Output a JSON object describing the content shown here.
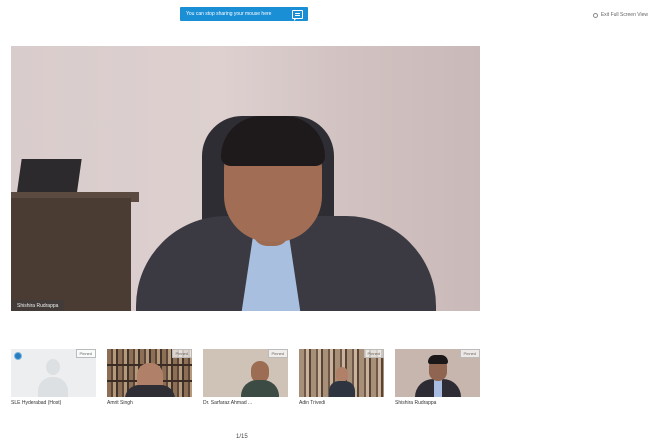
{
  "share_banner": {
    "text": "You can stop sharing your mouse here"
  },
  "exit_fullscreen": {
    "label": "Exit Full Screen View"
  },
  "main_video": {
    "name_tag": "Shishira Rudrappa"
  },
  "participants": [
    {
      "name": "SLE Hyderabad (Host)",
      "tag": "Pinned"
    },
    {
      "name": "Amrit Singh",
      "tag": "Pinned"
    },
    {
      "name": "Dr. Sarfaraz Ahmad ...",
      "tag": "Pinned"
    },
    {
      "name": "Adin Trivedi",
      "tag": "Pinned"
    },
    {
      "name": "Shishira Rudrappa",
      "tag": "Pinned"
    }
  ],
  "pager": {
    "text": "1/15"
  },
  "colors": {
    "banner": "#1a8fd6"
  }
}
